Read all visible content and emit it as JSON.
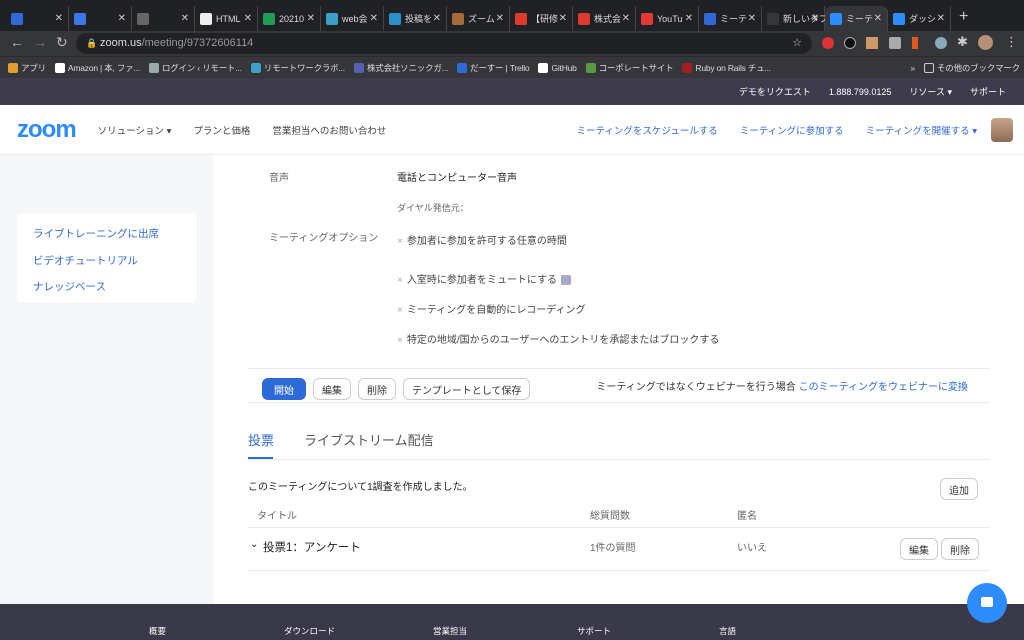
{
  "browser": {
    "tabs": [
      {
        "label": "",
        "color": "#2f6bd8"
      },
      {
        "label": "",
        "color": "#3b78e7"
      },
      {
        "label": "",
        "color": "#666666"
      },
      {
        "label": "HTML",
        "color": "#eeeeee"
      },
      {
        "label": "20210",
        "color": "#1e9e55"
      },
      {
        "label": "web会",
        "color": "#3aa0c8"
      },
      {
        "label": "投稿を",
        "color": "#2b8fc9"
      },
      {
        "label": "ズーム",
        "color": "#a56a3a"
      },
      {
        "label": "【研修",
        "color": "#e03a2f"
      },
      {
        "label": "株式会",
        "color": "#e03a2f"
      },
      {
        "label": "YouTu",
        "color": "#e53935"
      },
      {
        "label": "ミーテ",
        "color": "#2d6ad8"
      },
      {
        "label": "新しいタブ",
        "color": "#35363a"
      },
      {
        "label": "ミーテ",
        "color": "#2d8cff",
        "active": true
      },
      {
        "label": "ダッシ",
        "color": "#2d8cff"
      }
    ],
    "url_host": "zoom.us",
    "url_path": "/meeting/97372606114",
    "bookmarks": [
      {
        "label": "アプリ",
        "color": "#e0a030"
      },
      {
        "label": "Amazon | 本, ファ...",
        "color": "#ffffff"
      },
      {
        "label": "ログイン ‹ リモート...",
        "color": "#9aa"
      },
      {
        "label": "リモートワークラボ...",
        "color": "#3aa0c8"
      },
      {
        "label": "株式会社ソニックガ...",
        "color": "#5560b0"
      },
      {
        "label": "だーすー | Trello",
        "color": "#2f6bd8"
      },
      {
        "label": "GitHub",
        "color": "#ffffff"
      },
      {
        "label": "コーポレートサイト",
        "color": "#5a9a40"
      },
      {
        "label": "Ruby on Rails チュ...",
        "color": "#a02020"
      }
    ],
    "bookmarks_more": "»",
    "other_bookmarks": "その他のブックマーク"
  },
  "topbar": {
    "demo": "デモをリクエスト",
    "phone": "1.888.799.0125",
    "resources": "リソース ▾",
    "support": "サポート"
  },
  "header": {
    "logo": "zoom",
    "solutions": "ソリューション ▾",
    "pricing": "プランと価格",
    "contact": "営業担当へのお問い合わせ",
    "schedule": "ミーティングをスケジュールする",
    "join": "ミーティングに参加する",
    "host": "ミーティングを開催する ▾"
  },
  "sidebar": {
    "items": [
      "ライブトレーニングに出席",
      "ビデオチュートリアル",
      "ナレッジベース"
    ]
  },
  "details": {
    "audio_label": "音声",
    "audio_value": "電話とコンピューター音声",
    "dial_from": "ダイヤル発信元：",
    "options_label": "ミーティングオプション",
    "options": [
      "参加者に参加を許可する任意の時間",
      "入室時に参加者をミュートにする",
      "ミーティングを自動的にレコーディング",
      "特定の地域/国からのユーザーへのエントリを承認またはブロックする"
    ],
    "option_mark": "×"
  },
  "actions": {
    "start": "開始",
    "edit": "編集",
    "delete": "削除",
    "save_template": "テンプレートとして保存",
    "webinar_prompt": "ミーティングではなくウェビナーを行う場合",
    "webinar_link": "このミーティングをウェビナーに変換"
  },
  "tabs": {
    "poll": "投票",
    "livestream": "ライブストリーム配信"
  },
  "polls": {
    "summary": "このミーティングについて1調査を作成しました。",
    "add": "追加",
    "columns": [
      "タイトル",
      "総質問数",
      "匿名"
    ],
    "rows": [
      {
        "title": "投票1：アンケート",
        "questions": "1件の質問",
        "anonymous": "いいえ",
        "edit": "編集",
        "delete": "削除"
      }
    ]
  },
  "footer": [
    "概要",
    "ダウンロード",
    "営業担当",
    "サポート",
    "言語"
  ]
}
